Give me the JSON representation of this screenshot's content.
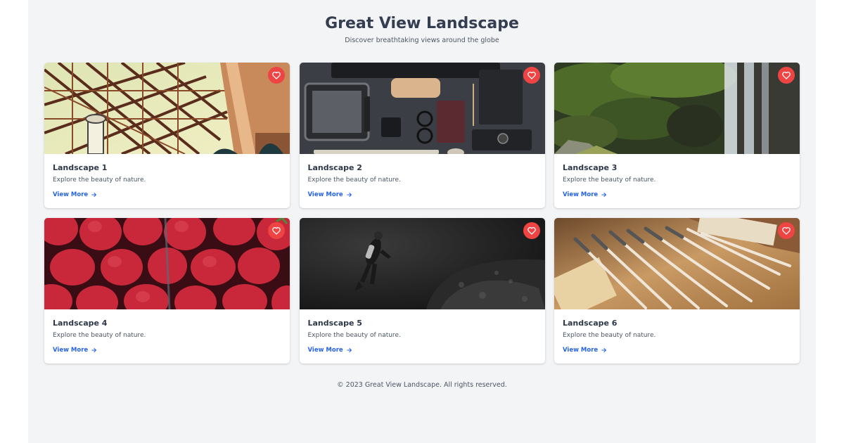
{
  "header": {
    "title": "Great View Landscape",
    "subtitle": "Discover breathtaking views around the globe"
  },
  "cards": [
    {
      "title": "Landscape 1",
      "description": "Explore the beauty of nature.",
      "link_label": "View More"
    },
    {
      "title": "Landscape 2",
      "description": "Explore the beauty of nature.",
      "link_label": "View More"
    },
    {
      "title": "Landscape 3",
      "description": "Explore the beauty of nature.",
      "link_label": "View More"
    },
    {
      "title": "Landscape 4",
      "description": "Explore the beauty of nature.",
      "link_label": "View More"
    },
    {
      "title": "Landscape 5",
      "description": "Explore the beauty of nature.",
      "link_label": "View More"
    },
    {
      "title": "Landscape 6",
      "description": "Explore the beauty of nature.",
      "link_label": "View More"
    }
  ],
  "icons": {
    "favorite": "heart-icon",
    "link": "arrow-right-icon"
  },
  "colors": {
    "page_background": "#f3f4f6",
    "favorite_button": "#ef4444",
    "link": "#2563eb",
    "title": "#353d51"
  },
  "footer": {
    "copyright": "© 2023 Great View Landscape. All rights reserved."
  }
}
